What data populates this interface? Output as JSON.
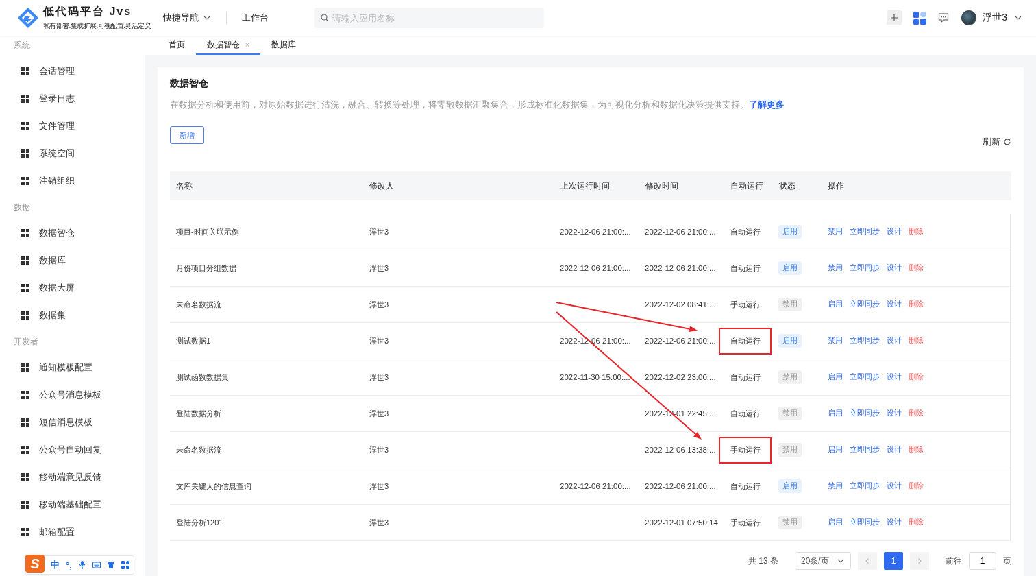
{
  "header": {
    "logo_title": "低代码平台 Jvs",
    "logo_subtitle": "私有部署.集成扩展.可视配置.灵活定义",
    "nav": [
      {
        "label": "快捷导航",
        "kind": "dropdown"
      },
      {
        "label": "工作台",
        "kind": "link"
      }
    ],
    "search": {
      "placeholder": "请输入应用名称"
    },
    "user": {
      "name": "浮世3"
    }
  },
  "sidebar": {
    "groups": [
      {
        "label": "系统",
        "items": [
          {
            "label": "会话管理",
            "selected": false
          },
          {
            "label": "登录日志",
            "selected": false
          },
          {
            "label": "文件管理",
            "selected": false
          },
          {
            "label": "系统空间",
            "selected": false
          },
          {
            "label": "注销组织",
            "selected": false
          }
        ]
      },
      {
        "label": "数据",
        "items": [
          {
            "label": "数据智仓",
            "selected": false
          },
          {
            "label": "数据库",
            "selected": false
          },
          {
            "label": "数据大屏",
            "selected": false
          },
          {
            "label": "数据集",
            "selected": false
          }
        ]
      },
      {
        "label": "开发者",
        "items": [
          {
            "label": "通知模板配置",
            "selected": false
          },
          {
            "label": "公众号消息模板",
            "selected": false
          },
          {
            "label": "短信消息模板",
            "selected": false
          },
          {
            "label": "公众号自动回复",
            "selected": false
          },
          {
            "label": "移动端意见反馈",
            "selected": false
          },
          {
            "label": "移动端基础配置",
            "selected": false
          },
          {
            "label": "邮箱配置",
            "selected": false
          }
        ]
      }
    ]
  },
  "tabs": [
    {
      "label": "首页",
      "selected": false
    },
    {
      "label": "数据智仓",
      "selected": true,
      "close": "×"
    },
    {
      "label": "数据库",
      "selected": false
    }
  ],
  "page": {
    "title": "数据智仓",
    "description": "在数据分析和使用前，对原始数据进行清洗，融合、转换等处理，将零散数据汇聚集合，形成标准化数据集，为可视化分析和数据化决策提供支持。",
    "learn_more": "了解更多",
    "add_button": "新增",
    "refresh": "刷新"
  },
  "table": {
    "columns": [
      "名称",
      "修改人",
      "上次运行时间",
      "修改时间",
      "自动运行",
      "状态",
      "操作"
    ],
    "rows": [
      {
        "name": "项目-时间关联示例",
        "modifier": "浮世3",
        "last_run": "2022-12-06 21:00:...",
        "modified": "2022-12-06 21:00:...",
        "run_mode": "自动运行",
        "highlighted": false,
        "status": {
          "label": "启用",
          "kind": "enabled"
        },
        "actions": [
          {
            "label": "禁用",
            "kind": "link"
          },
          {
            "label": "立即同步",
            "kind": "link"
          },
          {
            "label": "设计",
            "kind": "link"
          },
          {
            "label": "删除",
            "kind": "danger"
          }
        ]
      },
      {
        "name": "月份项目分组数据",
        "modifier": "浮世3",
        "last_run": "2022-12-06 21:00:...",
        "modified": "2022-12-06 21:00:...",
        "run_mode": "自动运行",
        "highlighted": false,
        "status": {
          "label": "启用",
          "kind": "enabled"
        },
        "actions": [
          {
            "label": "禁用",
            "kind": "link"
          },
          {
            "label": "立即同步",
            "kind": "link"
          },
          {
            "label": "设计",
            "kind": "link"
          },
          {
            "label": "删除",
            "kind": "danger"
          }
        ]
      },
      {
        "name": "未命名数据流",
        "modifier": "浮世3",
        "last_run": "",
        "modified": "2022-12-02 08:41:...",
        "run_mode": "手动运行",
        "highlighted": false,
        "status": {
          "label": "禁用",
          "kind": "disabled"
        },
        "actions": [
          {
            "label": "启用",
            "kind": "link"
          },
          {
            "label": "立即同步",
            "kind": "link"
          },
          {
            "label": "设计",
            "kind": "link"
          },
          {
            "label": "删除",
            "kind": "danger"
          }
        ]
      },
      {
        "name": "测试数据1",
        "modifier": "浮世3",
        "last_run": "2022-12-06 21:00:...",
        "modified": "2022-12-06 21:00:...",
        "run_mode": "自动运行",
        "highlighted": true,
        "status": {
          "label": "启用",
          "kind": "enabled"
        },
        "actions": [
          {
            "label": "禁用",
            "kind": "link"
          },
          {
            "label": "立即同步",
            "kind": "link"
          },
          {
            "label": "设计",
            "kind": "link"
          },
          {
            "label": "删除",
            "kind": "danger"
          }
        ]
      },
      {
        "name": "测试函数数据集",
        "modifier": "浮世3",
        "last_run": "2022-11-30 15:00:...",
        "modified": "2022-12-02 23:00:...",
        "run_mode": "自动运行",
        "highlighted": false,
        "status": {
          "label": "禁用",
          "kind": "disabled"
        },
        "actions": [
          {
            "label": "启用",
            "kind": "link"
          },
          {
            "label": "立即同步",
            "kind": "link"
          },
          {
            "label": "设计",
            "kind": "link"
          },
          {
            "label": "删除",
            "kind": "danger"
          }
        ]
      },
      {
        "name": "登陆数据分析",
        "modifier": "浮世3",
        "last_run": "",
        "modified": "2022-12-01 22:45:...",
        "run_mode": "自动运行",
        "highlighted": false,
        "status": {
          "label": "禁用",
          "kind": "disabled"
        },
        "actions": [
          {
            "label": "启用",
            "kind": "link"
          },
          {
            "label": "立即同步",
            "kind": "link"
          },
          {
            "label": "设计",
            "kind": "link"
          },
          {
            "label": "删除",
            "kind": "danger"
          }
        ]
      },
      {
        "name": "未命名数据流",
        "modifier": "浮世3",
        "last_run": "",
        "modified": "2022-12-06 13:38:...",
        "run_mode": "手动运行",
        "highlighted": true,
        "status": {
          "label": "禁用",
          "kind": "disabled"
        },
        "actions": [
          {
            "label": "启用",
            "kind": "link"
          },
          {
            "label": "立即同步",
            "kind": "link"
          },
          {
            "label": "设计",
            "kind": "link"
          },
          {
            "label": "删除",
            "kind": "danger"
          }
        ]
      },
      {
        "name": "文库关键人的信息查询",
        "modifier": "浮世3",
        "last_run": "2022-12-06 21:00:...",
        "modified": "2022-12-06 21:00:...",
        "run_mode": "自动运行",
        "highlighted": false,
        "status": {
          "label": "启用",
          "kind": "enabled"
        },
        "actions": [
          {
            "label": "禁用",
            "kind": "link"
          },
          {
            "label": "立即同步",
            "kind": "link"
          },
          {
            "label": "设计",
            "kind": "link"
          },
          {
            "label": "删除",
            "kind": "danger"
          }
        ]
      },
      {
        "name": "登陆分析1201",
        "modifier": "浮世3",
        "last_run": "",
        "modified": "2022-12-01 07:50:14",
        "run_mode": "手动运行",
        "highlighted": false,
        "status": {
          "label": "禁用",
          "kind": "disabled"
        },
        "actions": [
          {
            "label": "启用",
            "kind": "link"
          },
          {
            "label": "立即同步",
            "kind": "link"
          },
          {
            "label": "设计",
            "kind": "link"
          },
          {
            "label": "删除",
            "kind": "danger"
          }
        ]
      }
    ]
  },
  "pagination": {
    "total": "共 13 条",
    "page_size": "20条/页",
    "pages": [
      {
        "label": "1",
        "selected": true
      }
    ],
    "goto_label": "前往",
    "goto_value": "1",
    "goto_suffix": "页"
  },
  "ime_toolbar": {
    "logo": "S",
    "mode": "中",
    "punctuation": "°,"
  }
}
